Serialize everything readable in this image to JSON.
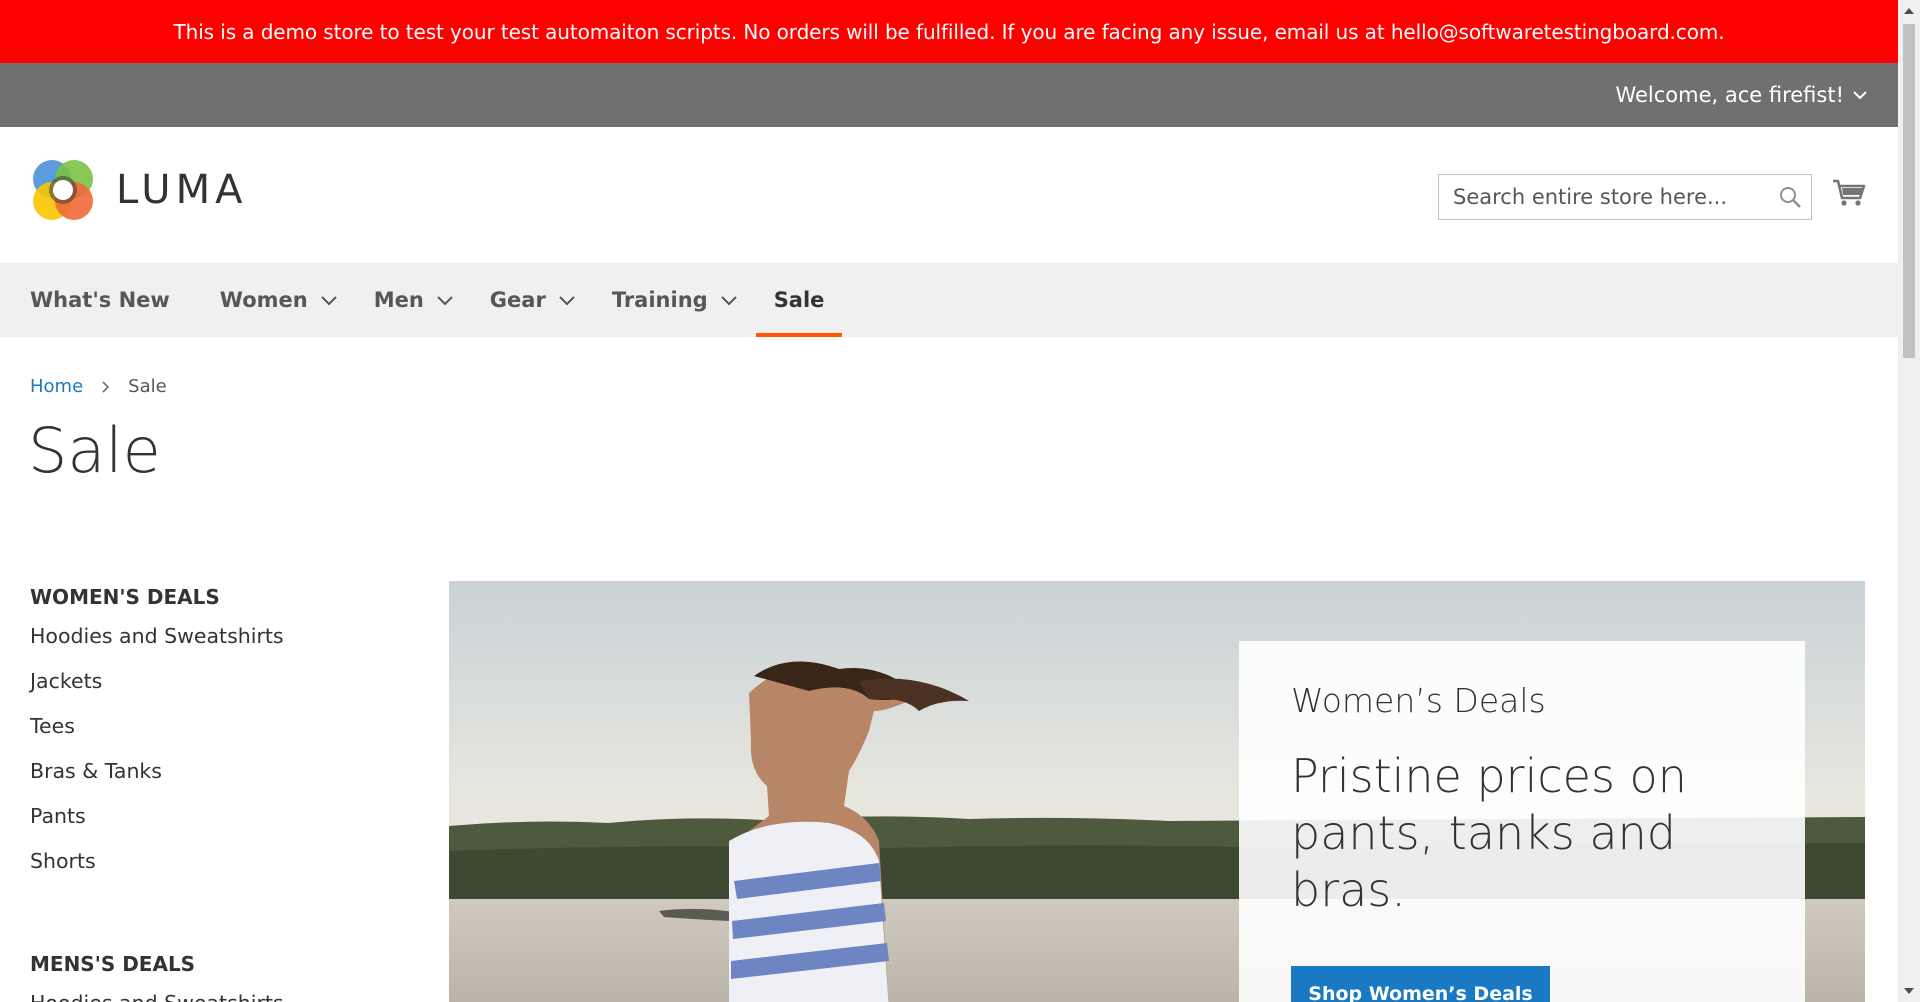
{
  "notice": {
    "text": "This is a demo store to test your test automaiton scripts. No orders will be fulfilled. If you are facing any issue, email us at hello@softwaretestingboard.com."
  },
  "panel": {
    "welcome": "Welcome, ace firefist!"
  },
  "logo": {
    "text": "LUMA"
  },
  "search": {
    "placeholder": "Search entire store here..."
  },
  "nav": {
    "items": [
      {
        "label": "What's New"
      },
      {
        "label": "Women"
      },
      {
        "label": "Men"
      },
      {
        "label": "Gear"
      },
      {
        "label": "Training"
      },
      {
        "label": "Sale"
      }
    ],
    "active": "Sale"
  },
  "breadcrumbs": {
    "home": "Home",
    "current": "Sale"
  },
  "page": {
    "title": "Sale"
  },
  "sidebar": {
    "womens_title": "WOMEN'S DEALS",
    "womens_items": [
      "Hoodies and Sweatshirts",
      "Jackets",
      "Tees",
      "Bras & Tanks",
      "Pants",
      "Shorts"
    ],
    "mens_title": "MENS'S DEALS",
    "mens_items": [
      "Hoodies and Sweatshirts"
    ]
  },
  "promo": {
    "subtitle": "Women’s Deals",
    "headline": "Pristine prices on pants, tanks and bras.",
    "button": "Shop Women’s Deals"
  },
  "colors": {
    "notice_bg": "#ff0000",
    "panel_bg": "#6e716e",
    "nav_bg": "#f0f0f0",
    "active_underline": "#ff5501",
    "link": "#1979c3",
    "button_bg": "#1979c3"
  }
}
